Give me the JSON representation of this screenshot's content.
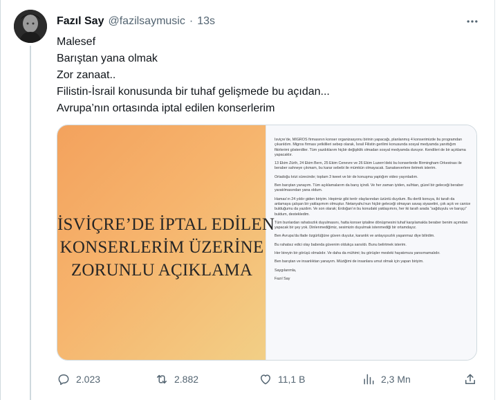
{
  "tweet": {
    "author_name": "Fazıl Say",
    "handle": "@fazilsaymusic",
    "separator": "·",
    "time": "13s",
    "lines": [
      "Malesef",
      "Barıştan yana olmak",
      "Zor zanaat..",
      "Filistin-İsrail konusunda bir tuhaf gelişmede bu açıdan...",
      "Avrupa’nın ortasında iptal edilen konserlerim"
    ]
  },
  "media": {
    "title_lines": [
      "İSVİÇRE’DE İPTAL EDİLEN",
      "KONSERLERİM ÜZERİNE",
      "ZORUNLU AÇIKLAMA"
    ],
    "document_paragraphs": [
      "İsviçre’de, MİGROS firmasının konser organizasyonu birinin yapacağı, planlanmış 4 konserimizde bu programdan çıkarıldım. Migros firması yetkilileri sebep olarak, İsrail Filistin gerilimi konusunda sosyal medyamda yanıttığım fikirlerimi gösterdiler. Tüm yazdıklarım hiçbir değişiklik olmadan sosyal medyamda duruyor. Kendileri de bir açıklama yapacaktır.",
      "13 Ekim Zürih, 24 Ekim Bern, 25 Ekim Cenevre ve 26 Ekim Luzern’deki bu konserlerde Birmingham Orkestrası ile beraber sahneye çıkmam, bu karar sebebi ile mümkün olmayacak. Sanatseverlere iletmek isterim.",
      "Ortadoğu krizi sürecinde; toplam 3 tweet ve bir de konuşma yaptığım video yayınladım.",
      "Ben barıştan yanayım. Tüm açıklamalarım da barış içindi. Ve her zaman iyiden, sulhtan, güzel bir geleceği beraber yaratılmasından yana oldum.",
      "Hamas’ın 24 yıldır giden biriyim. Hepimiz gibi terör olaylarından üzüntü duydum. Bu dertli konuya, iki tarafı da anlamaya çalışan bir yaklaşımım olmuştur. Netanyahu’nun hiçbir geleceği olmayan savaş siyasetini, çok açık ve canice bulduğumu da yazdım. Ve son olarak; Erdoğan’ın bu konudaki yaklaşımını, her iki tarafı arada “sağduyulu ve barışçı” buldum, destekledim.",
      "Tüm bunlardan rahatsızlık duyulmasını, hatta konser iptaline dönüşmesini tuhaf karşılamakla beraber benim açımdan yapacak bir şey yok. Dinlenmediğimiz, sesimizin duyulmak istenmediği bir ortamdayız.",
      "Ben Avrupa’da ifade özgürlüğüne güven duyulur, karanlık ve anlayışsızlık yaşanmaz diye bilirdim.",
      "Bu rahatsız edici olay babında güvenim oldukça sarsıldı. Bunu belirtmek isterim.",
      "Her bireyin bir görüşü olmalıdır. Ve daha da mühimi; bu görüşler mesleki hayatımıza yansımamalıdır.",
      "Ben barıştan ve insanlıktan yanayım. Müziğimi de insanlara umut olmak için yapan biriyim.",
      "Saygılarımla,",
      "Fazıl Say"
    ]
  },
  "actions": {
    "reply_count": "2.023",
    "retweet_count": "2.882",
    "like_count": "11,1 B",
    "views_count": "2,3 Mn"
  },
  "icons": {
    "reply": "reply-icon",
    "retweet": "retweet-icon",
    "like": "heart-icon",
    "views": "views-icon",
    "share": "share-icon",
    "more": "more-icon"
  },
  "colors": {
    "text_primary": "#0f1419",
    "text_secondary": "#536471",
    "border": "#cfd9de",
    "media_left_bg": "#f5ad66",
    "media_right_bg": "#f7f8fb"
  }
}
